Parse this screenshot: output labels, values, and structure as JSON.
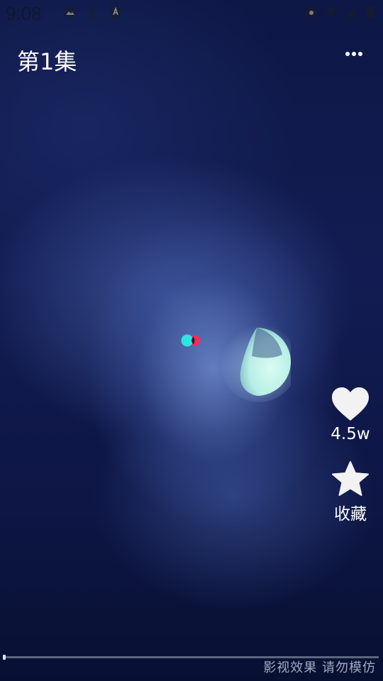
{
  "status_bar": {
    "time": "9:08",
    "left_icons": [
      "image-icon",
      "download-icon",
      "a-badge-icon"
    ],
    "right_icons": [
      "camera-icon",
      "wifi-icon",
      "signal-icon",
      "battery-icon"
    ]
  },
  "header": {
    "title": "第1集",
    "more_icon": "more-dots-icon"
  },
  "player": {
    "loading_icon": "loading-dots-icon",
    "progress_fraction": 0.0
  },
  "actions": {
    "like": {
      "icon": "heart-icon",
      "label": "4.5w"
    },
    "favorite": {
      "icon": "star-icon",
      "label": "收藏"
    }
  },
  "watermark": "影视效果 请勿模仿",
  "colors": {
    "accent_cyan": "#2ee6e0",
    "accent_red": "#ff2a55",
    "icon_white": "#f2f2f2"
  }
}
